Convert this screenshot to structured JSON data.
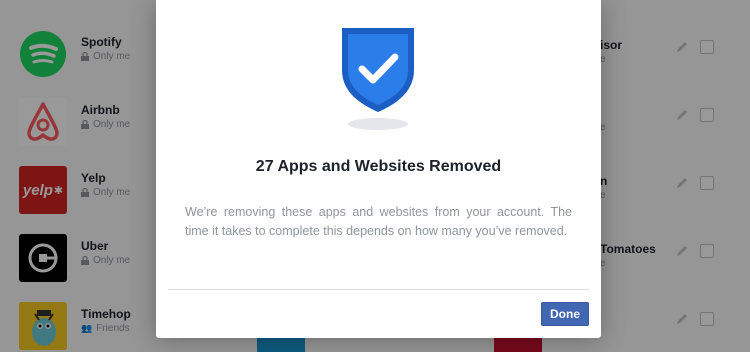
{
  "apps": [
    {
      "name": "Spotify",
      "privacy": "Only me",
      "logo": "spotify-logo"
    },
    {
      "name": "Airbnb",
      "privacy": "Only me",
      "logo": "airbnb-logo"
    },
    {
      "name": "Yelp",
      "privacy": "Only me",
      "logo": "yelp-logo",
      "logo_text": "yelp"
    },
    {
      "name": "Uber",
      "privacy": "Only me",
      "logo": "uber-logo"
    },
    {
      "name": "Timehop",
      "privacy": "Friends",
      "logo": "timehop-logo"
    }
  ],
  "right_column": [
    {
      "name": "isor",
      "privacy": "e"
    },
    {
      "name": "",
      "privacy": "e"
    },
    {
      "name": "n",
      "privacy": "e"
    },
    {
      "name": "Tomatoes",
      "privacy": "e"
    },
    {
      "name": "",
      "privacy": ""
    }
  ],
  "modal": {
    "title": "27 Apps and Websites Removed",
    "body": "We’re removing these apps and websites from your account. The time it takes to complete this depends on how many you’ve removed.",
    "done_label": "Done",
    "icon": "shield-check-icon"
  },
  "colors": {
    "primary": "#4267b2",
    "shield": "#2b7de9",
    "spotify": "#1ed760",
    "airbnb": "#ff5a5f",
    "yelp": "#d32323"
  }
}
